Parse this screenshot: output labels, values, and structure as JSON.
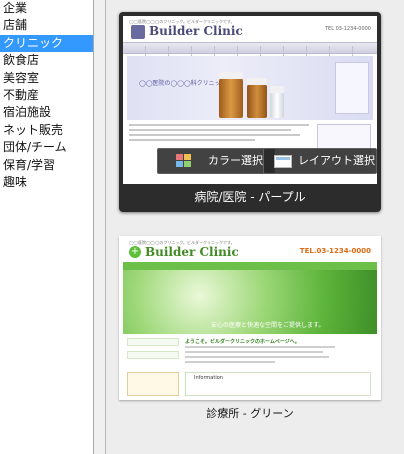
{
  "categories": {
    "items": [
      {
        "label": "企業"
      },
      {
        "label": "店舗"
      },
      {
        "label": "クリニック",
        "selected": true
      },
      {
        "label": "飲食店"
      },
      {
        "label": "美容室"
      },
      {
        "label": "不動産"
      },
      {
        "label": "宿泊施設"
      },
      {
        "label": "ネット販売"
      },
      {
        "label": "団体/チーム"
      },
      {
        "label": "保育/学習"
      },
      {
        "label": "趣味"
      }
    ]
  },
  "templates": [
    {
      "name": "病院/医院 - パープル",
      "selected": true,
      "preview": {
        "top_text": "◯◯医院◯◯◯のクリニック。ビルダークリニックです。",
        "site_title": "Builder Clinic",
        "hero_text": "◯◯医院の◯◯◯科クリニック",
        "tel": "TEL 03-1234-0000"
      },
      "color_button_label": "カラー選択",
      "layout_button_label": "レイアウト選択"
    },
    {
      "name": "診療所 - グリーン",
      "selected": false,
      "preview": {
        "top_text": "◯◯医院◯◯◯のクリニック。ビルダークリニックです。",
        "site_title": "Builder Clinic",
        "tel": "TEL.03-1234-0000",
        "hero_text": "安心の医療と快適な空間をご提供します。",
        "heading_text": "ようこそ。ビルダークリニックのホームページへ。",
        "info_title": "Information"
      }
    }
  ],
  "colors": {
    "selection_blue": "#3399ff",
    "selected_card_bg": "#2c2c2c",
    "purple_theme": "#4a4a78",
    "green_theme": "#6cc04a"
  }
}
